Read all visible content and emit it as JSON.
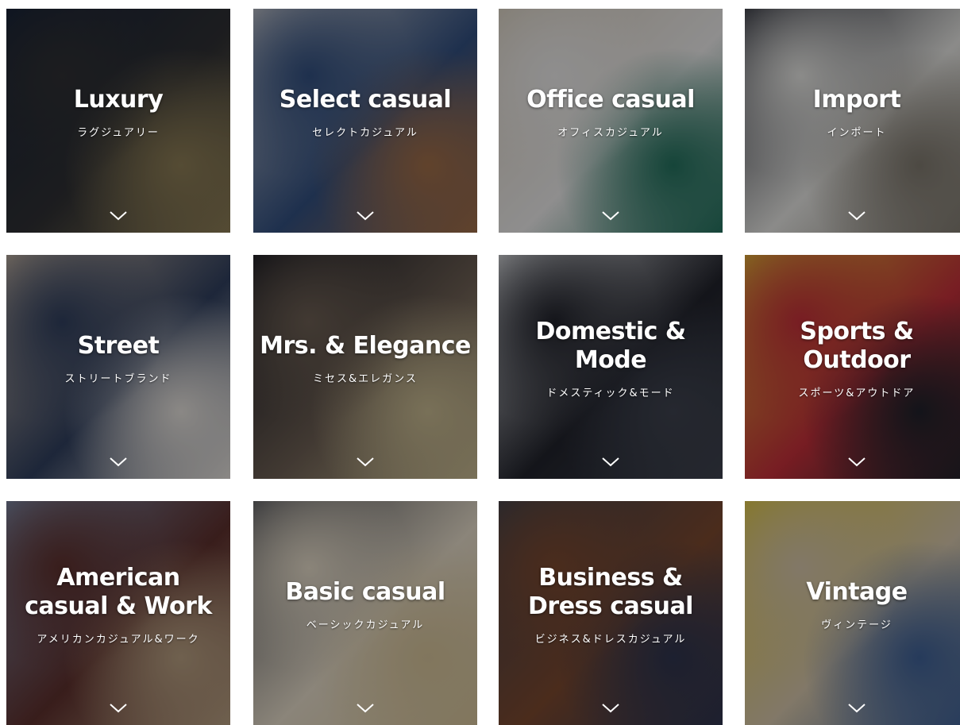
{
  "categories": [
    {
      "title": "Luxury",
      "subtitle": "ラグジュアリー",
      "colors": [
        "#0f1a2c",
        "#2b2a28",
        "#8c7a4c"
      ],
      "icon": "chevron-down-icon"
    },
    {
      "title": "Select casual",
      "subtitle": "セレクトカジュアル",
      "colors": [
        "#c8c6c4",
        "#2e4b78",
        "#a06a3e"
      ],
      "icon": "chevron-down-icon"
    },
    {
      "title": "Office casual",
      "subtitle": "オフィスカジュアル",
      "colors": [
        "#d9cdb6",
        "#efece7",
        "#1f6e55"
      ],
      "icon": "chevron-down-icon"
    },
    {
      "title": "Import",
      "subtitle": "インポート",
      "colors": [
        "#1d1e24",
        "#e9e7df",
        "#7e7666"
      ],
      "icon": "chevron-down-icon"
    },
    {
      "title": "Street",
      "subtitle": "ストリートブランド",
      "colors": [
        "#c9b59c",
        "#2c3a55",
        "#e8e2d8"
      ],
      "icon": "chevron-down-icon"
    },
    {
      "title": "Mrs. & Elegance",
      "subtitle": "ミセス&エレガンス",
      "colors": [
        "#0e0e12",
        "#6b5b4a",
        "#c9b98a"
      ],
      "icon": "chevron-down-icon"
    },
    {
      "title": "Domestic &\nMode",
      "subtitle": "ドメスティック&モード",
      "colors": [
        "#e6e6e4",
        "#1c1c20",
        "#3a3d45"
      ],
      "icon": "chevron-down-icon"
    },
    {
      "title": "Sports &\nOutdoor",
      "subtitle": "スポーツ&アウトドア",
      "colors": [
        "#e0b82a",
        "#c72a2f",
        "#1b1b1f"
      ],
      "icon": "chevron-down-icon"
    },
    {
      "title": "American\ncasual & Work",
      "subtitle": "アメリカンカジュアル&ワーク",
      "colors": [
        "#7a8ba6",
        "#5b2a22",
        "#b99e7a"
      ],
      "icon": "chevron-down-icon"
    },
    {
      "title": "Basic casual",
      "subtitle": "ベーシックカジュアル",
      "colors": [
        "#4a4a4c",
        "#e8dcc4",
        "#d8c393"
      ],
      "icon": "chevron-down-icon"
    },
    {
      "title": "Business &\nDress casual",
      "subtitle": "ビジネス&ドレスカジュアル",
      "colors": [
        "#3b3c42",
        "#7a4424",
        "#2a2f45"
      ],
      "icon": "chevron-down-icon"
    },
    {
      "title": "Vintage",
      "subtitle": "ヴィンテージ",
      "colors": [
        "#e1c52f",
        "#d9c7a5",
        "#3b5d90"
      ],
      "icon": "chevron-down-icon"
    }
  ]
}
